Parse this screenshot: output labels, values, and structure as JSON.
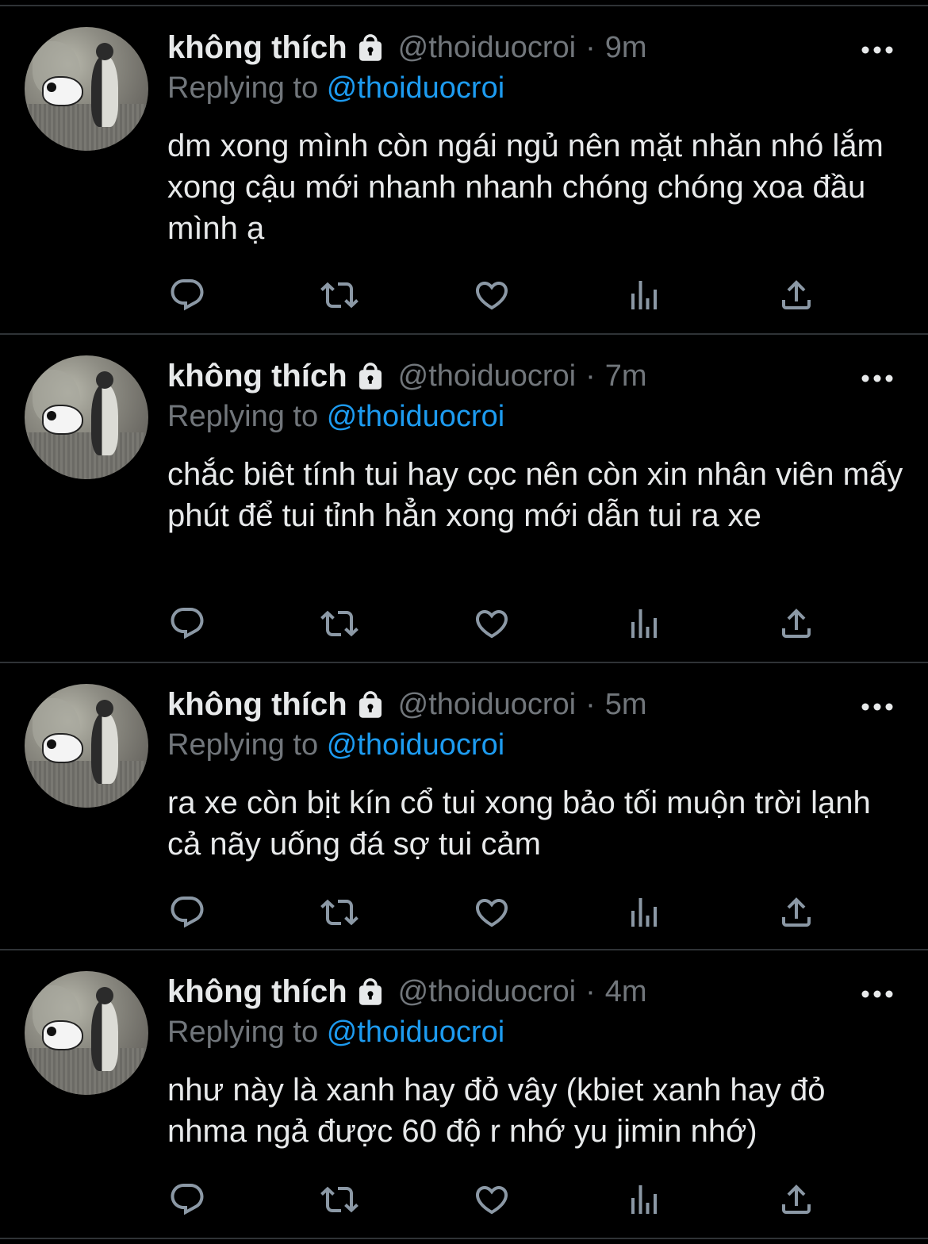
{
  "colors": {
    "background": "#000000",
    "text": "#e7e9ea",
    "secondary": "#71767b",
    "accent": "#1d9bf0",
    "divider": "#2f3336"
  },
  "tweets": [
    {
      "name": "không thích",
      "handle": "@thoiduocroi",
      "separator": "·",
      "time": "9m",
      "replying_prefix": "Replying to",
      "replying_mention": "@thoiduocroi",
      "text": "dm xong mình còn ngái ngủ nên mặt nhăn nhó lắm xong cậu mới nhanh nhanh chóng chóng xoa đầu mình ạ",
      "icons": [
        "lock-icon",
        "more-icon",
        "reply-icon",
        "retweet-icon",
        "like-icon",
        "analytics-icon",
        "share-icon"
      ]
    },
    {
      "name": "không thích",
      "handle": "@thoiduocroi",
      "separator": "·",
      "time": "7m",
      "replying_prefix": "Replying to",
      "replying_mention": "@thoiduocroi",
      "text": "chắc biêt tính tui hay cọc nên còn xin nhân viên mấy phút để tui tỉnh hẳn xong mới dẫn tui ra xe",
      "icons": [
        "lock-icon",
        "more-icon",
        "reply-icon",
        "retweet-icon",
        "like-icon",
        "analytics-icon",
        "share-icon"
      ]
    },
    {
      "name": "không thích",
      "handle": "@thoiduocroi",
      "separator": "·",
      "time": "5m",
      "replying_prefix": "Replying to",
      "replying_mention": "@thoiduocroi",
      "text": "ra xe còn bịt kín cổ tui xong bảo tối muộn trời lạnh cả nãy uống đá sợ tui cảm",
      "icons": [
        "lock-icon",
        "more-icon",
        "reply-icon",
        "retweet-icon",
        "like-icon",
        "analytics-icon",
        "share-icon"
      ]
    },
    {
      "name": "không thích",
      "handle": "@thoiduocroi",
      "separator": "·",
      "time": "4m",
      "replying_prefix": "Replying to",
      "replying_mention": "@thoiduocroi",
      "text": "như này là xanh hay đỏ vây (kbiet xanh hay đỏ nhma ngả được 60 độ r nhớ yu jimin nhớ)",
      "icons": [
        "lock-icon",
        "more-icon",
        "reply-icon",
        "retweet-icon",
        "like-icon",
        "analytics-icon",
        "share-icon"
      ]
    }
  ]
}
